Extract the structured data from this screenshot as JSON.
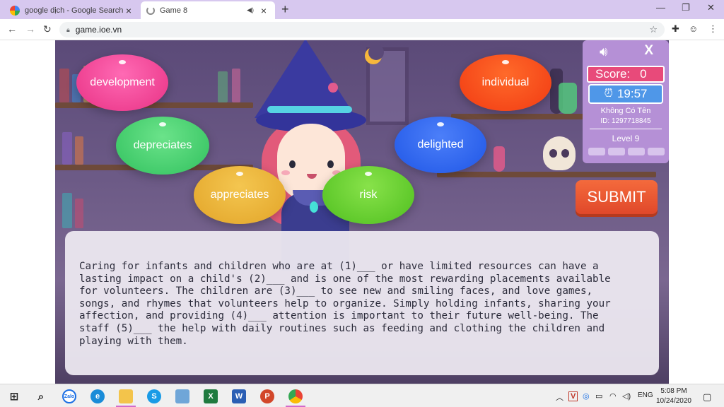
{
  "browser": {
    "tabs": [
      {
        "title": "google dịch - Google Search",
        "active": false
      },
      {
        "title": "Game 8",
        "active": true
      }
    ],
    "new_tab": "+",
    "url": "game.ioe.vn",
    "window_controls": [
      "—",
      "❐",
      "✕"
    ]
  },
  "game": {
    "words": [
      "development",
      "depreciates",
      "appreciates",
      "risk",
      "delighted",
      "individual"
    ],
    "panel": {
      "score_label": "Score:",
      "score_value": "0",
      "timer": "19:57",
      "player_name": "Không Có Tên",
      "player_id": "ID: 1297718845",
      "level": "Level 9",
      "close": "X"
    },
    "submit_label": "SUBMIT",
    "passage": "Caring for infants and children who are at (1)___ or have limited resources can have a\nlasting impact on a child's (2)___ and is one of the most rewarding placements available\nfor volunteers. The children are (3)___ to see new and smiling faces, and love games,\nsongs, and rhymes that volunteers help to organize. Simply holding infants, sharing your\naffection, and providing (4)___ attention is important to their future well-being. The\nstaff (5)___ the help with daily routines such as feeding and clothing the children and\nplaying with them."
  },
  "taskbar": {
    "apps": [
      "start",
      "search",
      "zalo",
      "edge",
      "file-explorer",
      "skype",
      "network",
      "excel",
      "word",
      "powerpoint",
      "chrome"
    ],
    "language": "ENG",
    "time": "5:08 PM",
    "date": "10/24/2020"
  },
  "colors": {
    "tabbar": "#d7c8ef",
    "panel": "#b590d6",
    "score": "#e84a7a",
    "timer": "#4f97e8",
    "submit": "#e0482a"
  }
}
